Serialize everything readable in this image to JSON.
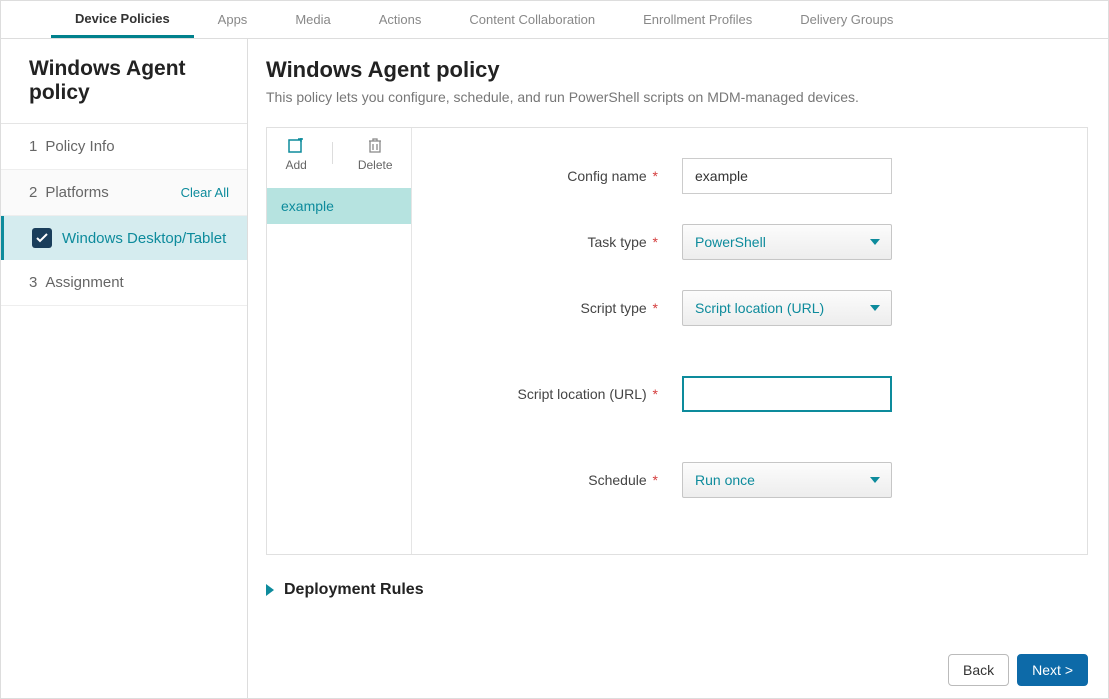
{
  "topnav": {
    "tabs": [
      {
        "label": "Device Policies",
        "active": true
      },
      {
        "label": "Apps"
      },
      {
        "label": "Media"
      },
      {
        "label": "Actions"
      },
      {
        "label": "Content Collaboration"
      },
      {
        "label": "Enrollment Profiles"
      },
      {
        "label": "Delivery Groups"
      }
    ]
  },
  "sidebar": {
    "title": "Windows Agent policy",
    "steps": {
      "step1": {
        "num": "1",
        "label": "Policy Info"
      },
      "step2": {
        "num": "2",
        "label": "Platforms",
        "clear_all": "Clear All"
      },
      "step2_sub": {
        "label": "Windows Desktop/Tablet",
        "checked": true
      },
      "step3": {
        "num": "3",
        "label": "Assignment"
      }
    }
  },
  "page": {
    "title": "Windows Agent policy",
    "description": "This policy lets you configure, schedule, and run PowerShell scripts on MDM-managed devices."
  },
  "panel": {
    "actions": {
      "add": "Add",
      "delete": "Delete"
    },
    "items": [
      {
        "label": "example"
      }
    ]
  },
  "form": {
    "config_name": {
      "label": "Config name",
      "value": "example"
    },
    "task_type": {
      "label": "Task type",
      "value": "PowerShell"
    },
    "script_type": {
      "label": "Script type",
      "value": "Script location (URL)"
    },
    "script_location": {
      "label": "Script location (URL)",
      "value": ""
    },
    "schedule": {
      "label": "Schedule",
      "value": "Run once"
    }
  },
  "deployment_rules": {
    "label": "Deployment Rules"
  },
  "footer": {
    "back": "Back",
    "next": "Next >"
  }
}
